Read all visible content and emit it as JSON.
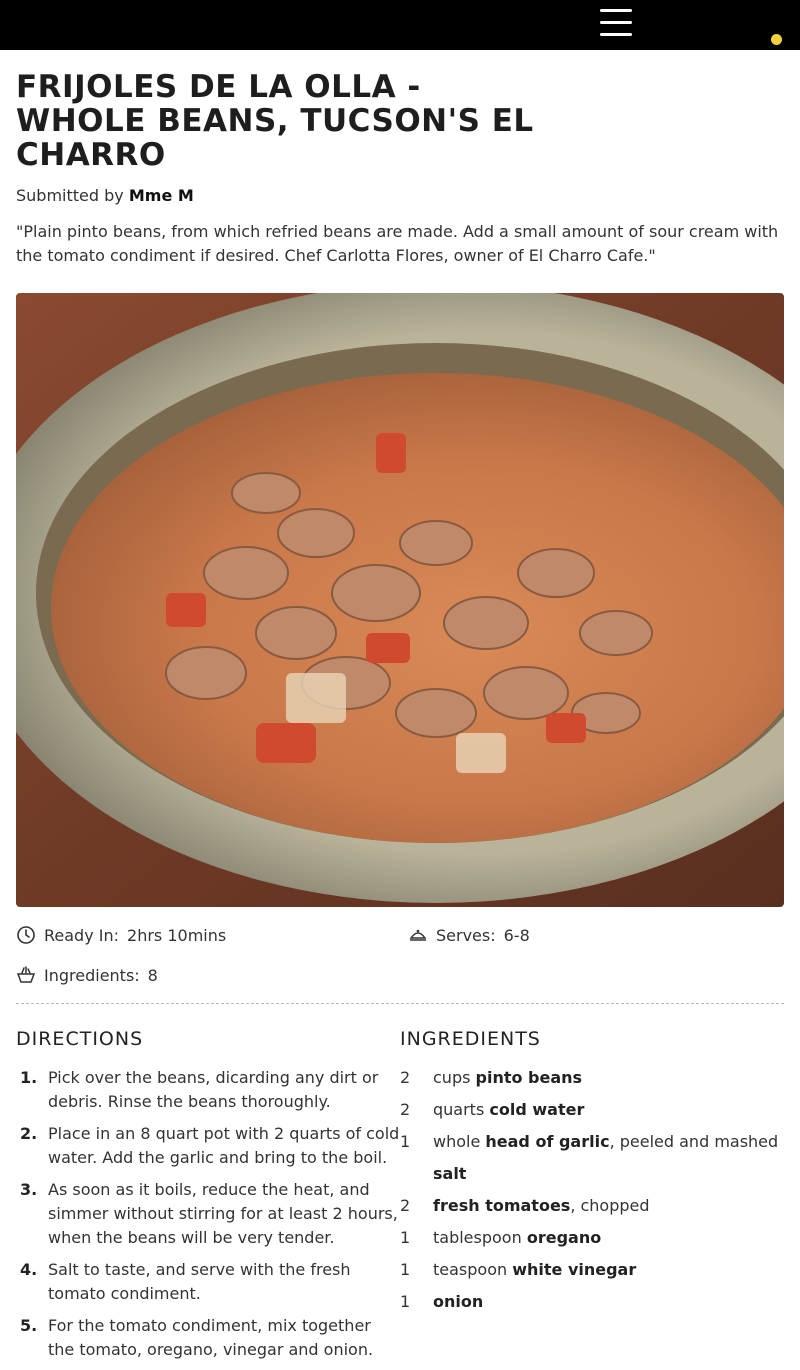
{
  "header": {
    "menu_icon": "hamburger-menu-icon",
    "accent_color": "#f5d03a"
  },
  "recipe": {
    "title": "FRIJOLES DE LA OLLA - WHOLE BEANS, TUCSON'S EL CHARRO",
    "submitted_prefix": "Submitted by",
    "author": "Mme M",
    "description": "\"Plain pinto beans, from which refried beans are made. Add a small amount of sour cream with the tomato condiment if desired. Chef Carlotta Flores, owner of El Charro Cafe.\""
  },
  "meta": {
    "ready_label": "Ready In:",
    "ready_value": "2hrs 10mins",
    "serves_label": "Serves:",
    "serves_value": "6-8",
    "ingredients_label": "Ingredients:",
    "ingredients_value": "8"
  },
  "directions": {
    "heading": "DIRECTIONS",
    "steps": [
      {
        "num": "1.",
        "text": "Pick over the beans, dicarding any dirt or debris. Rinse the beans thoroughly."
      },
      {
        "num": "2.",
        "text": "Place in an 8 quart pot with 2 quarts of cold water. Add the garlic and bring to the boil."
      },
      {
        "num": "3.",
        "text": "As soon as it boils, reduce the heat, and simmer without stirring for at least 2 hours, when the beans will be very tender."
      },
      {
        "num": "4.",
        "text": "Salt to taste, and serve with the fresh tomato condiment."
      },
      {
        "num": "5.",
        "text": "For the tomato condiment, mix together the tomato, oregano, vinegar and onion."
      }
    ]
  },
  "ingredients": {
    "heading": "INGREDIENTS",
    "items": [
      {
        "qty": "2",
        "unit": "cups ",
        "name": "pinto beans",
        "note": ""
      },
      {
        "qty": "2",
        "unit": "quarts ",
        "name": "cold water",
        "note": ""
      },
      {
        "qty": "1",
        "unit": "whole ",
        "name": "head of garlic",
        "note": ", peeled and mashed"
      },
      {
        "qty": "",
        "unit": "",
        "name": "salt",
        "note": ""
      },
      {
        "qty": "2",
        "unit": "",
        "name": "fresh tomatoes",
        "note": ", chopped"
      },
      {
        "qty": "1",
        "unit": "tablespoon ",
        "name": "oregano",
        "note": ""
      },
      {
        "qty": "1",
        "unit": "teaspoon ",
        "name": "white vinegar",
        "note": ""
      },
      {
        "qty": "1",
        "unit": "",
        "name": "onion",
        "note": ""
      }
    ]
  }
}
